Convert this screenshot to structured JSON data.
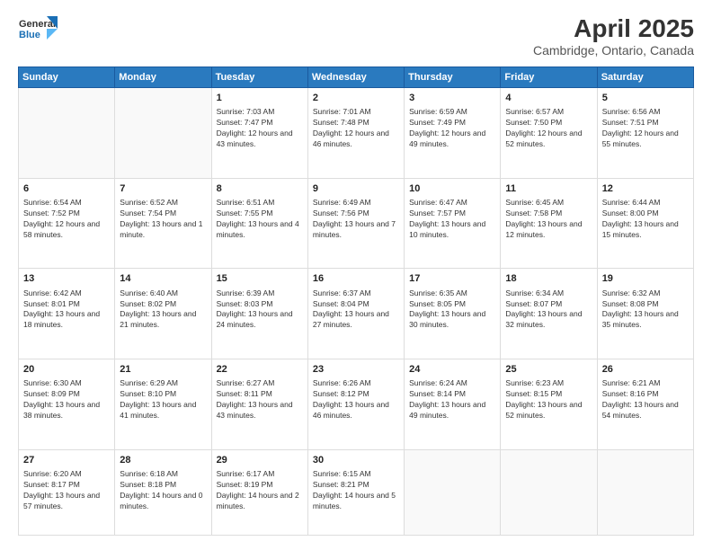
{
  "header": {
    "logo": {
      "general": "General",
      "blue": "Blue"
    },
    "title": "April 2025",
    "location": "Cambridge, Ontario, Canada"
  },
  "calendar": {
    "days_of_week": [
      "Sunday",
      "Monday",
      "Tuesday",
      "Wednesday",
      "Thursday",
      "Friday",
      "Saturday"
    ],
    "weeks": [
      [
        {
          "day": "",
          "info": ""
        },
        {
          "day": "",
          "info": ""
        },
        {
          "day": "1",
          "info": "Sunrise: 7:03 AM\nSunset: 7:47 PM\nDaylight: 12 hours and 43 minutes."
        },
        {
          "day": "2",
          "info": "Sunrise: 7:01 AM\nSunset: 7:48 PM\nDaylight: 12 hours and 46 minutes."
        },
        {
          "day": "3",
          "info": "Sunrise: 6:59 AM\nSunset: 7:49 PM\nDaylight: 12 hours and 49 minutes."
        },
        {
          "day": "4",
          "info": "Sunrise: 6:57 AM\nSunset: 7:50 PM\nDaylight: 12 hours and 52 minutes."
        },
        {
          "day": "5",
          "info": "Sunrise: 6:56 AM\nSunset: 7:51 PM\nDaylight: 12 hours and 55 minutes."
        }
      ],
      [
        {
          "day": "6",
          "info": "Sunrise: 6:54 AM\nSunset: 7:52 PM\nDaylight: 12 hours and 58 minutes."
        },
        {
          "day": "7",
          "info": "Sunrise: 6:52 AM\nSunset: 7:54 PM\nDaylight: 13 hours and 1 minute."
        },
        {
          "day": "8",
          "info": "Sunrise: 6:51 AM\nSunset: 7:55 PM\nDaylight: 13 hours and 4 minutes."
        },
        {
          "day": "9",
          "info": "Sunrise: 6:49 AM\nSunset: 7:56 PM\nDaylight: 13 hours and 7 minutes."
        },
        {
          "day": "10",
          "info": "Sunrise: 6:47 AM\nSunset: 7:57 PM\nDaylight: 13 hours and 10 minutes."
        },
        {
          "day": "11",
          "info": "Sunrise: 6:45 AM\nSunset: 7:58 PM\nDaylight: 13 hours and 12 minutes."
        },
        {
          "day": "12",
          "info": "Sunrise: 6:44 AM\nSunset: 8:00 PM\nDaylight: 13 hours and 15 minutes."
        }
      ],
      [
        {
          "day": "13",
          "info": "Sunrise: 6:42 AM\nSunset: 8:01 PM\nDaylight: 13 hours and 18 minutes."
        },
        {
          "day": "14",
          "info": "Sunrise: 6:40 AM\nSunset: 8:02 PM\nDaylight: 13 hours and 21 minutes."
        },
        {
          "day": "15",
          "info": "Sunrise: 6:39 AM\nSunset: 8:03 PM\nDaylight: 13 hours and 24 minutes."
        },
        {
          "day": "16",
          "info": "Sunrise: 6:37 AM\nSunset: 8:04 PM\nDaylight: 13 hours and 27 minutes."
        },
        {
          "day": "17",
          "info": "Sunrise: 6:35 AM\nSunset: 8:05 PM\nDaylight: 13 hours and 30 minutes."
        },
        {
          "day": "18",
          "info": "Sunrise: 6:34 AM\nSunset: 8:07 PM\nDaylight: 13 hours and 32 minutes."
        },
        {
          "day": "19",
          "info": "Sunrise: 6:32 AM\nSunset: 8:08 PM\nDaylight: 13 hours and 35 minutes."
        }
      ],
      [
        {
          "day": "20",
          "info": "Sunrise: 6:30 AM\nSunset: 8:09 PM\nDaylight: 13 hours and 38 minutes."
        },
        {
          "day": "21",
          "info": "Sunrise: 6:29 AM\nSunset: 8:10 PM\nDaylight: 13 hours and 41 minutes."
        },
        {
          "day": "22",
          "info": "Sunrise: 6:27 AM\nSunset: 8:11 PM\nDaylight: 13 hours and 43 minutes."
        },
        {
          "day": "23",
          "info": "Sunrise: 6:26 AM\nSunset: 8:12 PM\nDaylight: 13 hours and 46 minutes."
        },
        {
          "day": "24",
          "info": "Sunrise: 6:24 AM\nSunset: 8:14 PM\nDaylight: 13 hours and 49 minutes."
        },
        {
          "day": "25",
          "info": "Sunrise: 6:23 AM\nSunset: 8:15 PM\nDaylight: 13 hours and 52 minutes."
        },
        {
          "day": "26",
          "info": "Sunrise: 6:21 AM\nSunset: 8:16 PM\nDaylight: 13 hours and 54 minutes."
        }
      ],
      [
        {
          "day": "27",
          "info": "Sunrise: 6:20 AM\nSunset: 8:17 PM\nDaylight: 13 hours and 57 minutes."
        },
        {
          "day": "28",
          "info": "Sunrise: 6:18 AM\nSunset: 8:18 PM\nDaylight: 14 hours and 0 minutes."
        },
        {
          "day": "29",
          "info": "Sunrise: 6:17 AM\nSunset: 8:19 PM\nDaylight: 14 hours and 2 minutes."
        },
        {
          "day": "30",
          "info": "Sunrise: 6:15 AM\nSunset: 8:21 PM\nDaylight: 14 hours and 5 minutes."
        },
        {
          "day": "",
          "info": ""
        },
        {
          "day": "",
          "info": ""
        },
        {
          "day": "",
          "info": ""
        }
      ]
    ]
  }
}
